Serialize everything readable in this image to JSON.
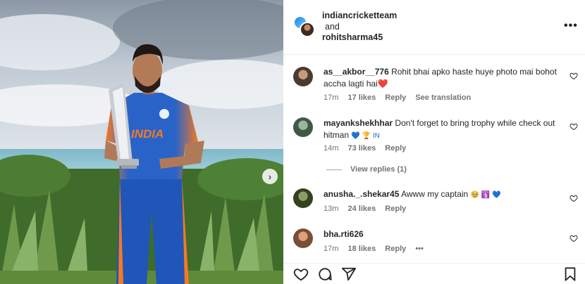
{
  "post": {
    "user1": "indiancricketteam",
    "and": "and",
    "user2": "rohitsharma45"
  },
  "comments": [
    {
      "username": "as__akbor__776",
      "text": "Rohit bhai apko haste huye photo mai bohot accha lagti hai",
      "emoji": "❤️",
      "time": "17m",
      "likes": "17 likes",
      "reply": "Reply",
      "translate": "See translation"
    },
    {
      "username": "mayankshekhhar",
      "text": "Don't forget to bring trophy while check out hitman",
      "emoji": "💙 🏆 IN",
      "time": "14m",
      "likes": "73 likes",
      "reply": "Reply"
    },
    {
      "username": "anusha._.shekar45",
      "text": "Awww my captain",
      "emoji": "🥹 🛐 💙",
      "time": "13m",
      "likes": "24 likes",
      "reply": "Reply"
    },
    {
      "username": "bha.rti626",
      "text": "",
      "time": "17m",
      "likes": "18 likes",
      "reply": "Reply",
      "more": "•••"
    }
  ],
  "view_replies": "View replies (1)",
  "icons": {
    "header_more": "more-options-icon",
    "heart": "heart-icon",
    "actions": [
      "like-icon",
      "comment-icon",
      "share-icon",
      "save-icon"
    ],
    "carousel": "chevron-right-icon"
  },
  "colors": {
    "username": "#262626",
    "meta": "#737373",
    "heart_red": "#ed4956",
    "photo_jersey": "#1f5fc4"
  }
}
